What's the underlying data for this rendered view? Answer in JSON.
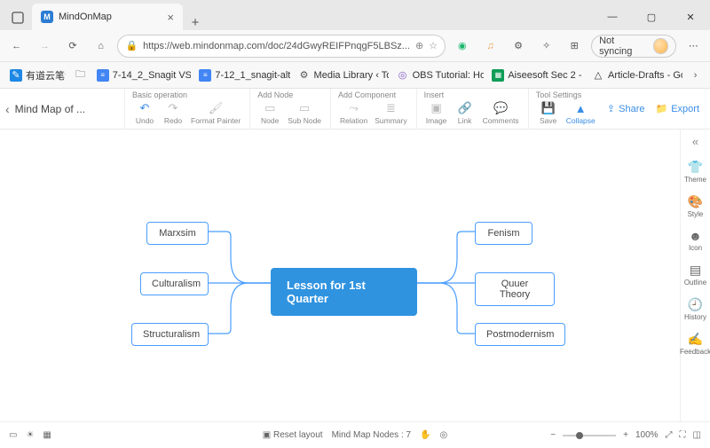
{
  "browser": {
    "tab_title": "MindOnMap",
    "url": "https://web.mindonmap.com/doc/24dGwyREIFPnqgF5LBSz...",
    "sync_label": "Not syncing"
  },
  "bookmarks": [
    {
      "label": "有道云笔记",
      "icon": "note-blue"
    },
    {
      "label": "7-14_2_Snagit VS S...",
      "icon": "gdoc"
    },
    {
      "label": "7-12_1_snagit-alter...",
      "icon": "gdoc"
    },
    {
      "label": "Media Library ‹ Top...",
      "icon": "wp"
    },
    {
      "label": "OBS Tutorial: How...",
      "icon": "obs"
    },
    {
      "label": "Aiseesoft Sec 2 - W...",
      "icon": "gsheet"
    },
    {
      "label": "Article-Drafts - Goo...",
      "icon": "gdrive"
    }
  ],
  "doc_title": "Mind Map of ...",
  "toolbar": {
    "groups": {
      "basic": {
        "label": "Basic operation",
        "undo": "Undo",
        "redo": "Redo",
        "format": "Format Painter"
      },
      "add_node": {
        "label": "Add Node",
        "node": "Node",
        "sub": "Sub Node"
      },
      "add_comp": {
        "label": "Add Component",
        "relation": "Relation",
        "summary": "Summary"
      },
      "insert": {
        "label": "Insert",
        "image": "Image",
        "link": "Link",
        "comments": "Comments"
      },
      "tool": {
        "label": "Tool Settings",
        "save": "Save",
        "collapse": "Collapse"
      }
    },
    "share": "Share",
    "export": "Export"
  },
  "sidepanel": {
    "theme": "Theme",
    "style": "Style",
    "icon": "Icon",
    "outline": "Outline",
    "history": "History",
    "feedback": "Feedback"
  },
  "mindmap": {
    "center": "Lesson for  1st Quarter",
    "left": [
      "Marxsim",
      "Culturalism",
      "Structuralism"
    ],
    "right": [
      "Fenism",
      "Quuer Theory",
      "Postmodernism"
    ]
  },
  "status": {
    "reset": "Reset layout",
    "nodes_label": "Mind Map Nodes :",
    "nodes_count": "7",
    "zoom": "100%"
  }
}
